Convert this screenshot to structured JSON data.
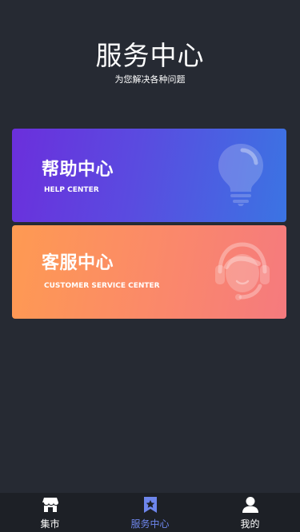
{
  "header": {
    "title": "服务中心",
    "subtitle": "为您解决各种问题"
  },
  "cards": [
    {
      "title": "帮助中心",
      "subtitle": "HELP CENTER",
      "icon": "lightbulb-icon",
      "gradient": [
        "#6b2fdc",
        "#3b74e3"
      ]
    },
    {
      "title": "客服中心",
      "subtitle": "CUSTOMER SERVICE CENTER",
      "icon": "customer-service-headset-icon",
      "gradient": [
        "#fe9a52",
        "#f57a7e"
      ]
    }
  ],
  "tabbar": {
    "items": [
      {
        "label": "集市",
        "icon": "store-icon",
        "active": false
      },
      {
        "label": "服务中心",
        "icon": "bookmark-star-icon",
        "active": true
      },
      {
        "label": "我的",
        "icon": "user-icon",
        "active": false
      }
    ]
  },
  "colors": {
    "background": "#262a33",
    "tabbar_background": "#1d2026",
    "active_tab": "#6e86ec",
    "text": "#ffffff"
  }
}
